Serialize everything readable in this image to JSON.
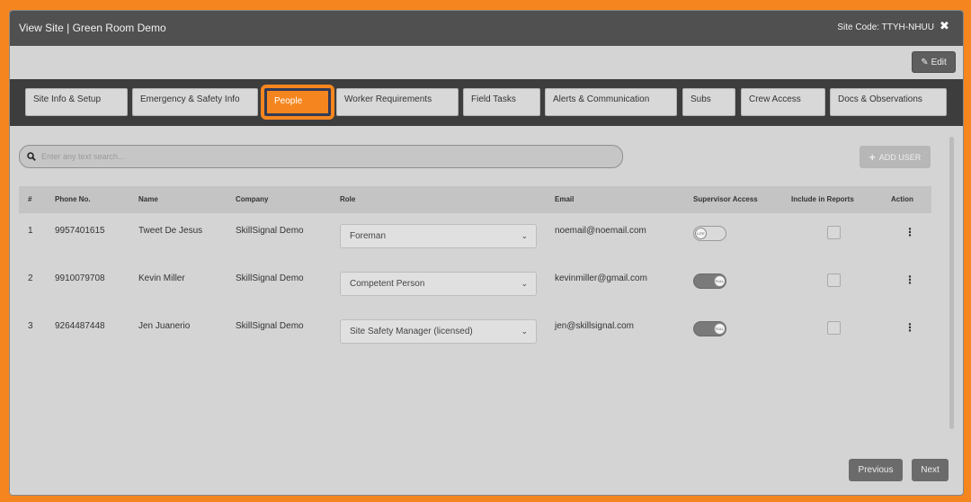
{
  "header": {
    "title": "View Site | Green Room Demo",
    "site_code": "Site Code: TTYH-NHUU",
    "close_icon": "✖"
  },
  "toolbar": {
    "edit_label": "Edit",
    "edit_icon": "✎"
  },
  "tabs": [
    {
      "label": "Site Info & Setup",
      "active": false
    },
    {
      "label": "Emergency & Safety Info",
      "active": false
    },
    {
      "label": "People",
      "active": true
    },
    {
      "label": "Worker Requirements",
      "active": false
    },
    {
      "label": "Field Tasks",
      "active": false
    },
    {
      "label": "Alerts & Communication",
      "active": false
    },
    {
      "label": "Subs",
      "active": false
    },
    {
      "label": "Crew Access",
      "active": false
    },
    {
      "label": "Docs & Observations",
      "active": false
    }
  ],
  "search": {
    "placeholder": "Enter any text search...",
    "value": ""
  },
  "add_user": {
    "label": "ADD USER",
    "icon": "plus-icon"
  },
  "table": {
    "headers": [
      "#",
      "Phone No.",
      "Name",
      "Company",
      "Role",
      "Email",
      "Supervisor Access",
      "Include in Reports",
      "Action"
    ],
    "rows": [
      {
        "num": "1",
        "phone": "9957401615",
        "name": "Tweet De Jesus",
        "company": "SkillSignal Demo",
        "role": "Foreman",
        "email": "noemail@noemail.com",
        "supervisor_access": false,
        "toggle_text": "LITE",
        "include_in_reports": false
      },
      {
        "num": "2",
        "phone": "9910079708",
        "name": "Kevin Miller",
        "company": "SkillSignal Demo",
        "role": "Competent Person",
        "email": "kevinmiller@gmail.com",
        "supervisor_access": true,
        "toggle_text": "FULL",
        "include_in_reports": false
      },
      {
        "num": "3",
        "phone": "9264487448",
        "name": "Jen Juanerio",
        "company": "SkillSignal Demo",
        "role": "Site Safety Manager (licensed)",
        "email": "jen@skillsignal.com",
        "supervisor_access": true,
        "toggle_text": "FULL",
        "include_in_reports": false
      }
    ]
  },
  "pagination": {
    "previous_label": "Previous",
    "next_label": "Next"
  },
  "colors": {
    "accent": "#f5861f",
    "header_bg": "#505050",
    "tabbar_bg": "#3d3d3d"
  }
}
